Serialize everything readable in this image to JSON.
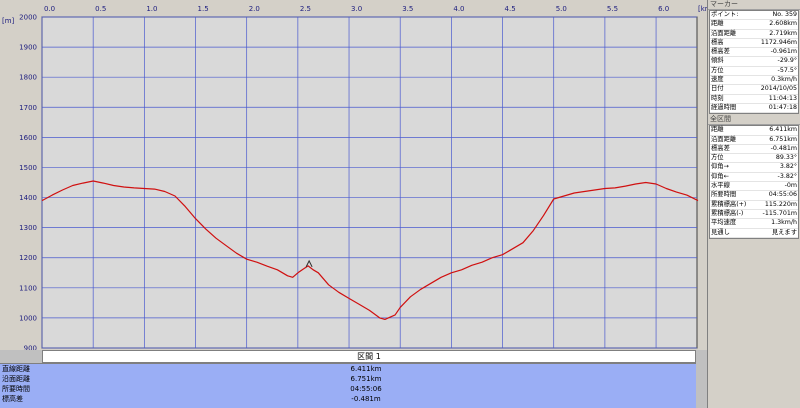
{
  "chart_data": {
    "type": "line",
    "x_unit": "km",
    "y_unit": "m",
    "xlim": [
      0,
      6.4
    ],
    "ylim": [
      900,
      2000
    ],
    "x_ticks": [
      "0.0",
      "0.5",
      "1.0",
      "1.5",
      "2.0",
      "2.5",
      "3.0",
      "3.5",
      "4.0",
      "4.5",
      "5.0",
      "5.5",
      "6.0"
    ],
    "y_ticks": [
      "2000",
      "1900",
      "1800",
      "1700",
      "1600",
      "1500",
      "1400",
      "1300",
      "1200",
      "1100",
      "1000",
      "900"
    ],
    "marker": {
      "x": 2.61,
      "y": 1173
    },
    "x": [
      0.0,
      0.1,
      0.2,
      0.3,
      0.4,
      0.5,
      0.6,
      0.7,
      0.8,
      0.9,
      1.0,
      1.1,
      1.2,
      1.3,
      1.4,
      1.5,
      1.6,
      1.7,
      1.8,
      1.9,
      2.0,
      2.1,
      2.2,
      2.3,
      2.4,
      2.45,
      2.5,
      2.55,
      2.6,
      2.65,
      2.7,
      2.8,
      2.9,
      3.0,
      3.1,
      3.2,
      3.3,
      3.35,
      3.45,
      3.5,
      3.6,
      3.7,
      3.8,
      3.9,
      4.0,
      4.1,
      4.2,
      4.3,
      4.4,
      4.5,
      4.6,
      4.7,
      4.8,
      4.9,
      5.0,
      5.1,
      5.2,
      5.3,
      5.4,
      5.5,
      5.6,
      5.7,
      5.8,
      5.9,
      6.0,
      6.1,
      6.2,
      6.3,
      6.41
    ],
    "y": [
      1390,
      1408,
      1425,
      1440,
      1448,
      1455,
      1448,
      1440,
      1435,
      1432,
      1430,
      1428,
      1420,
      1405,
      1370,
      1330,
      1295,
      1265,
      1240,
      1215,
      1195,
      1185,
      1172,
      1160,
      1140,
      1135,
      1150,
      1162,
      1173,
      1160,
      1150,
      1110,
      1085,
      1065,
      1045,
      1025,
      1000,
      995,
      1010,
      1035,
      1070,
      1095,
      1115,
      1135,
      1150,
      1160,
      1175,
      1185,
      1200,
      1210,
      1230,
      1250,
      1290,
      1340,
      1395,
      1405,
      1415,
      1420,
      1425,
      1430,
      1432,
      1438,
      1445,
      1450,
      1445,
      1430,
      1418,
      1408,
      1390
    ]
  },
  "section_header": "区間 1",
  "summary": [
    {
      "label": "直線距離",
      "value": "6.411km"
    },
    {
      "label": "沿面距離",
      "value": "6.751km"
    },
    {
      "label": "所要時間",
      "value": "04:55:06"
    },
    {
      "label": "標高差",
      "value": "-0.481m"
    }
  ],
  "marker_panel": {
    "title": "マーカー",
    "rows": [
      {
        "label": "ポイント:",
        "value": "No. 359"
      },
      {
        "label": "距離",
        "value": "2.608km"
      },
      {
        "label": "沿面距離",
        "value": "2.719km"
      },
      {
        "label": "標高",
        "value": "1172.946m"
      },
      {
        "label": "標高差",
        "value": "-0.961m"
      },
      {
        "label": "傾斜",
        "value": "-29.9°"
      },
      {
        "label": "方位",
        "value": "-57.5°"
      },
      {
        "label": "速度",
        "value": "0.3km/h"
      },
      {
        "label": "日付",
        "value": "2014/10/05"
      },
      {
        "label": "時刻",
        "value": "11:04:13"
      },
      {
        "label": "経過時間",
        "value": "01:47:18"
      }
    ]
  },
  "section_panel": {
    "title": "全区間",
    "rows": [
      {
        "label": "距離",
        "value": "6.411km"
      },
      {
        "label": "沿面距離",
        "value": "6.751km"
      },
      {
        "label": "標高差",
        "value": "-0.481m"
      },
      {
        "label": "方位",
        "value": "89.33°"
      },
      {
        "label": "仰角→",
        "value": "3.82°"
      },
      {
        "label": "仰角←",
        "value": "-3.82°"
      },
      {
        "label": "水平線",
        "value": "-0m"
      },
      {
        "label": "所要時間",
        "value": "04:55:06"
      },
      {
        "label": "累積標高(+)",
        "value": "115.220m"
      },
      {
        "label": "累積標高(-)",
        "value": "-115.701m"
      },
      {
        "label": "平均速度",
        "value": "1.3km/h"
      },
      {
        "label": "見通し",
        "value": "見えます"
      }
    ]
  },
  "colors": {
    "plot_bg": "#d9d9d9",
    "grid": "#4a5acf",
    "line": "#d01010",
    "summary_bg": "#9aaef5"
  }
}
